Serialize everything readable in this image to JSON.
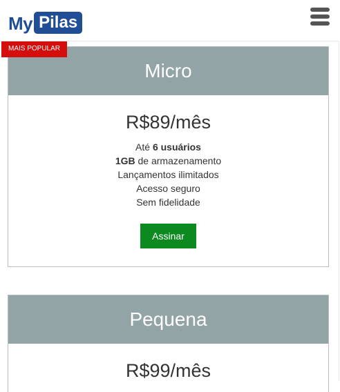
{
  "header": {
    "logo_my": "My",
    "logo_pilas": "Pilas",
    "menu_icon": "hamburger-icon"
  },
  "badge": "MAIS POPULAR",
  "plans": [
    {
      "name": "Micro",
      "price": "R$89/mês",
      "features": {
        "f1_pre": "Até ",
        "f1_bold": "6 usuários",
        "f2_bold": "1GB",
        "f2_post": " de armazenamento",
        "f3": "Lançamentos ilimitados",
        "f4": "Acesso seguro",
        "f5": "Sem fidelidade"
      },
      "button": "Assinar"
    },
    {
      "name": "Pequena",
      "price": "R$99/mês"
    }
  ],
  "colors": {
    "brand": "#1f4e96",
    "card_header": "#93a4a7",
    "badge": "#d40d0d",
    "button": "#0d8a1f"
  }
}
